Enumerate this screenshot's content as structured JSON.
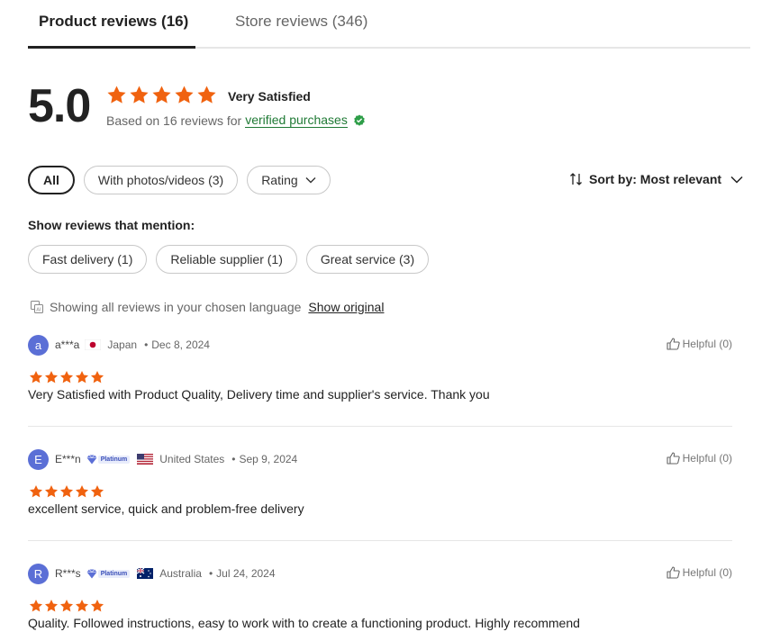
{
  "tabs": [
    {
      "label": "Product reviews (16)"
    },
    {
      "label": "Store reviews (346)"
    }
  ],
  "summary": {
    "score": "5.0",
    "rating_label": "Very Satisfied",
    "based_on": "Based on 16 reviews for",
    "verified_label": "verified purchases",
    "star_color": "#f0620f",
    "verified_color": "#1f7a35"
  },
  "filters": {
    "all": "All",
    "photos": "With photos/videos (3)",
    "rating": "Rating"
  },
  "sort": {
    "label": "Sort by: Most relevant"
  },
  "mentions": {
    "title": "Show reviews that mention:",
    "items": [
      "Fast delivery (1)",
      "Reliable supplier (1)",
      "Great service (3)"
    ]
  },
  "language": {
    "notice": "Showing all reviews in your chosen language",
    "show_original": "Show original"
  },
  "reviews": [
    {
      "initial": "a",
      "user": "a***a",
      "badge": "",
      "flag": "japan-flag-icon",
      "country": "Japan",
      "date": "Dec 8, 2024",
      "helpful": "Helpful (0)",
      "stars": 5,
      "text": "Very Satisfied with Product Quality, Delivery time and supplier's service. Thank you"
    },
    {
      "initial": "E",
      "user": "E***n",
      "badge": "Platinum",
      "flag": "us-flag-icon",
      "country": "United States",
      "date": "Sep 9, 2024",
      "helpful": "Helpful (0)",
      "stars": 5,
      "text": "excellent service, quick and problem-free delivery"
    },
    {
      "initial": "R",
      "user": "R***s",
      "badge": "Platinum",
      "flag": "australia-flag-icon",
      "country": "Australia",
      "date": "Jul 24, 2024",
      "helpful": "Helpful (0)",
      "stars": 5,
      "text": "Quality. Followed instructions, easy to work with to create a functioning product. Highly recommend"
    }
  ],
  "separator": "•"
}
